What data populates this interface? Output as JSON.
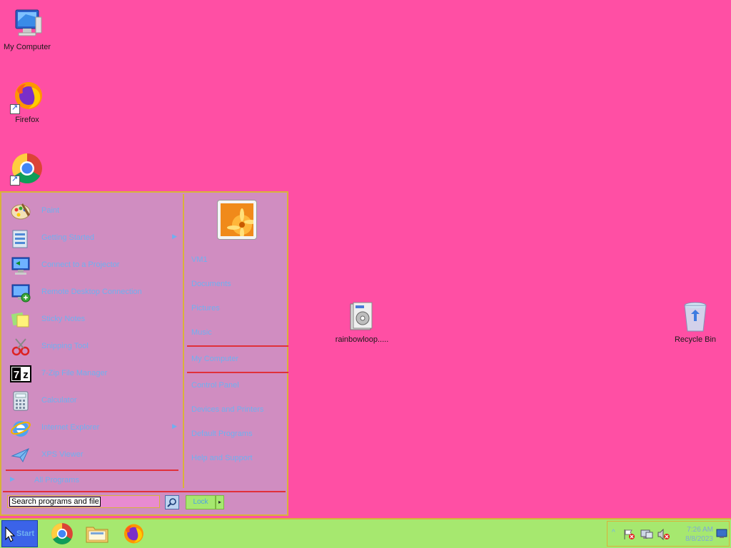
{
  "desktop": {
    "background_color": "#ff4fa4",
    "icons": [
      {
        "label": "My Computer",
        "icon": "monitor-icon"
      },
      {
        "label": "Firefox",
        "icon": "firefox-icon"
      },
      {
        "label": "",
        "icon": "chrome-icon"
      },
      {
        "label": "rainbowloop.....",
        "icon": "installer-icon"
      },
      {
        "label": "Recycle Bin",
        "icon": "recycle-bin-icon"
      }
    ]
  },
  "start_menu": {
    "programs": [
      {
        "label": "Paint",
        "icon": "paint-palette-icon",
        "has_submenu": false
      },
      {
        "label": "Getting Started",
        "icon": "getting-started-icon",
        "has_submenu": true
      },
      {
        "label": "Connect to a Projector",
        "icon": "projector-icon",
        "has_submenu": false
      },
      {
        "label": "Remote Desktop Connection",
        "icon": "remote-desktop-icon",
        "has_submenu": false
      },
      {
        "label": "Sticky Notes",
        "icon": "sticky-notes-icon",
        "has_submenu": false
      },
      {
        "label": "Snipping Tool",
        "icon": "scissors-icon",
        "has_submenu": false
      },
      {
        "label": "7-Zip File Manager",
        "icon": "7zip-icon",
        "has_submenu": false
      },
      {
        "label": "Calculator",
        "icon": "calculator-icon",
        "has_submenu": false
      },
      {
        "label": "Internet Explorer",
        "icon": "internet-explorer-icon",
        "has_submenu": true
      },
      {
        "label": "XPS Viewer",
        "icon": "xps-viewer-icon",
        "has_submenu": false
      }
    ],
    "all_programs": "All Programs",
    "user_picture_icon": "flower-picture-icon",
    "right_items_group1": [
      "VM1",
      "Documents",
      "Pictures",
      "Music"
    ],
    "right_items_group2": [
      "My Computer"
    ],
    "right_items_group3": [
      "Control Panel",
      "Devices and Printers",
      "Default Programs",
      "Help and Support"
    ],
    "search_placeholder": "Search programs and files",
    "lock_label": "Lock",
    "lock_arrow": "▸"
  },
  "taskbar": {
    "start_label": "Start",
    "pinned": [
      {
        "name": "chrome",
        "icon": "chrome-icon"
      },
      {
        "name": "file-explorer",
        "icon": "folder-icon"
      },
      {
        "name": "firefox",
        "icon": "firefox-icon"
      }
    ],
    "tray": {
      "show_hidden_glyph": "^",
      "time": "7:26 AM",
      "date": "8/8/2023"
    }
  },
  "colors": {
    "menu_bg": "#d08dc1",
    "menu_border": "#d8b23a",
    "separator": "#e0303a",
    "menu_text": "#6fb0f0",
    "taskbar_bg": "#a6e86f",
    "start_button": "#3b63e8"
  }
}
